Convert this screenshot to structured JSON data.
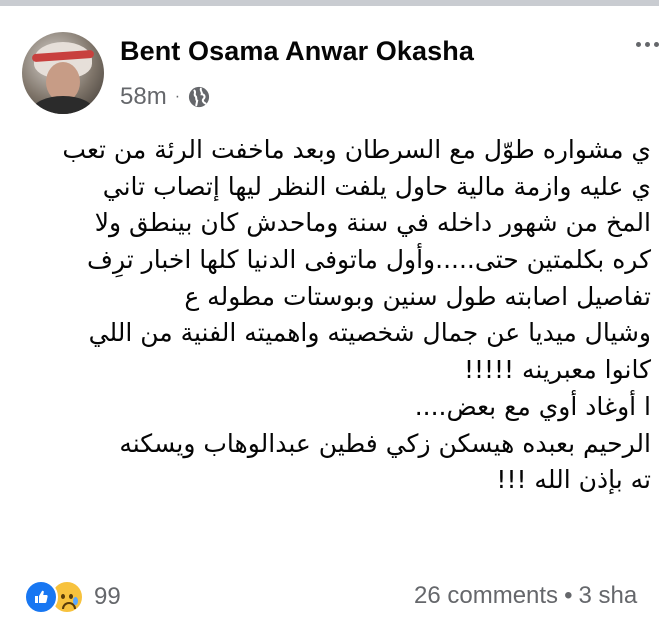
{
  "post": {
    "author": "Bent Osama Anwar Okasha",
    "time": "58m",
    "privacy_icon": "globe-icon",
    "menu_icon": "more-icon",
    "body_lines": [
      "ي مشواره طوّل مع السرطان وبعد ماخفت الرئة من تعب",
      "ي عليه وازمة مالية حاول يلفت النظر ليها إتصاب تاني",
      "المخ من شهور داخله في سنة وماحدش كان بينطق ولا",
      "كره بكلمتين حتى.....وأول ماتوفى الدنيا كلها اخبار ترِف",
      "تفاصيل اصابته طول سنين وبوستات مطوله ع",
      "وشيال ميديا عن جمال شخصيته واهميته الفنية من اللي",
      "كانوا معبرينه !!!!!",
      "ا أوغاد أوي مع بعض....",
      "الرحيم بعبده هيسكن زكي فطين عبدالوهاب ويسكنه",
      "ته بإذن الله !!!"
    ],
    "reactions": {
      "icons": [
        "like-icon",
        "sad-icon"
      ],
      "count": "99"
    },
    "comments": "26 comments",
    "separator": "•",
    "shares": "3 sha"
  },
  "colors": {
    "top_bar": "#c9ccd1",
    "secondary_text": "#65676b",
    "like_blue": "#1877f2",
    "sad_yellow": "#f7c23d"
  }
}
